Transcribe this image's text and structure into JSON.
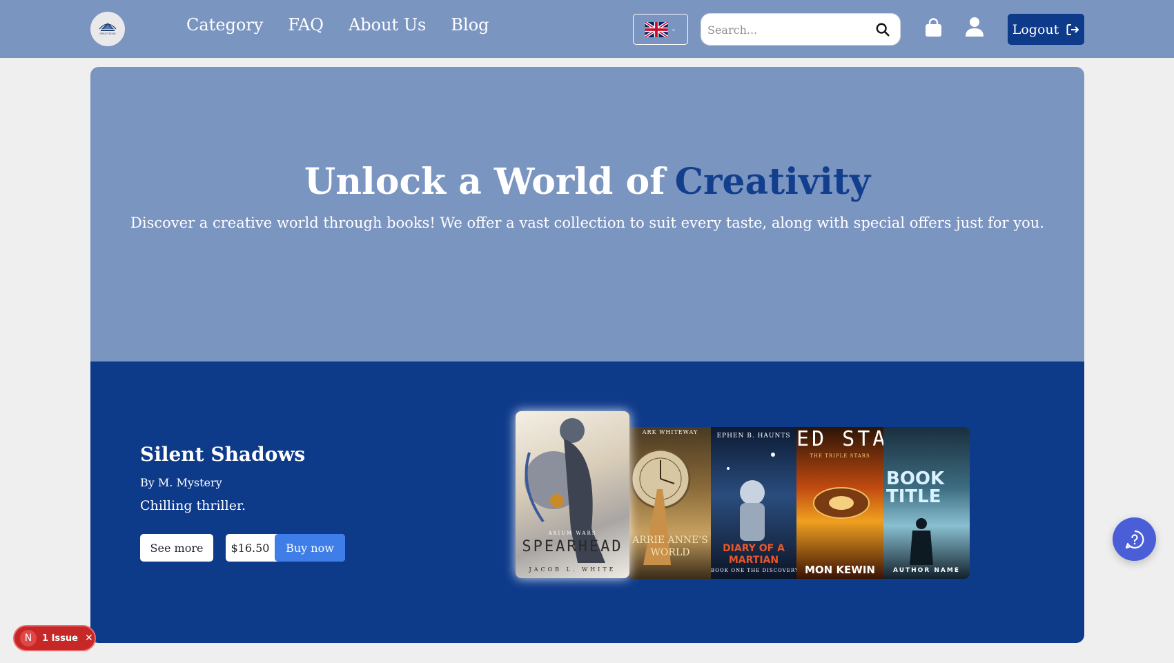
{
  "header": {
    "logo_text": "GREAT BOOK",
    "nav": [
      "Category",
      "FAQ",
      "About Us",
      "Blog"
    ],
    "language_flag": "uk-flag-icon",
    "search_placeholder": "Search...",
    "logout_label": "Logout"
  },
  "hero": {
    "title_main": "Unlock a World of",
    "title_accent": "Creativity",
    "subtitle": "Discover a creative world through books! We offer a vast collection to suit every taste, along with special offers just for you."
  },
  "featured": {
    "title": "Silent Shadows",
    "author": "By M. Mystery",
    "description": "Chilling thriller.",
    "see_more_label": "See more",
    "price": "$16.50",
    "buy_label": "Buy now"
  },
  "covers": [
    {
      "title": "SPEARHEAD",
      "author": "JACOB L. WHITE",
      "series": "AXIUM WARS"
    },
    {
      "title": "ARRIE ANNE'S WORLD",
      "author": "ARK WHITEWAY"
    },
    {
      "title": "DIARY OF A MARTIAN",
      "author": "EPHEN B. HAUNTS",
      "subtitle": "BOOK ONE THE DISCOVERY"
    },
    {
      "title": "ED STAR",
      "author": "MON KEWIN",
      "subtitle": "THE TRIPLE STARS"
    },
    {
      "title": "BOOK TITLE",
      "author": "AUTHOR NAME"
    }
  ],
  "dev_badge": {
    "letter": "N",
    "label": "1 Issue"
  },
  "colors": {
    "header_bg": "#7b95c1",
    "hero_bg": "#7b95c1",
    "band_bg": "#0e3a8a",
    "accent": "#123e8e",
    "buy_button": "#3f7ee8",
    "chat_button": "#4a5ed8",
    "issue_badge": "#c62828"
  }
}
